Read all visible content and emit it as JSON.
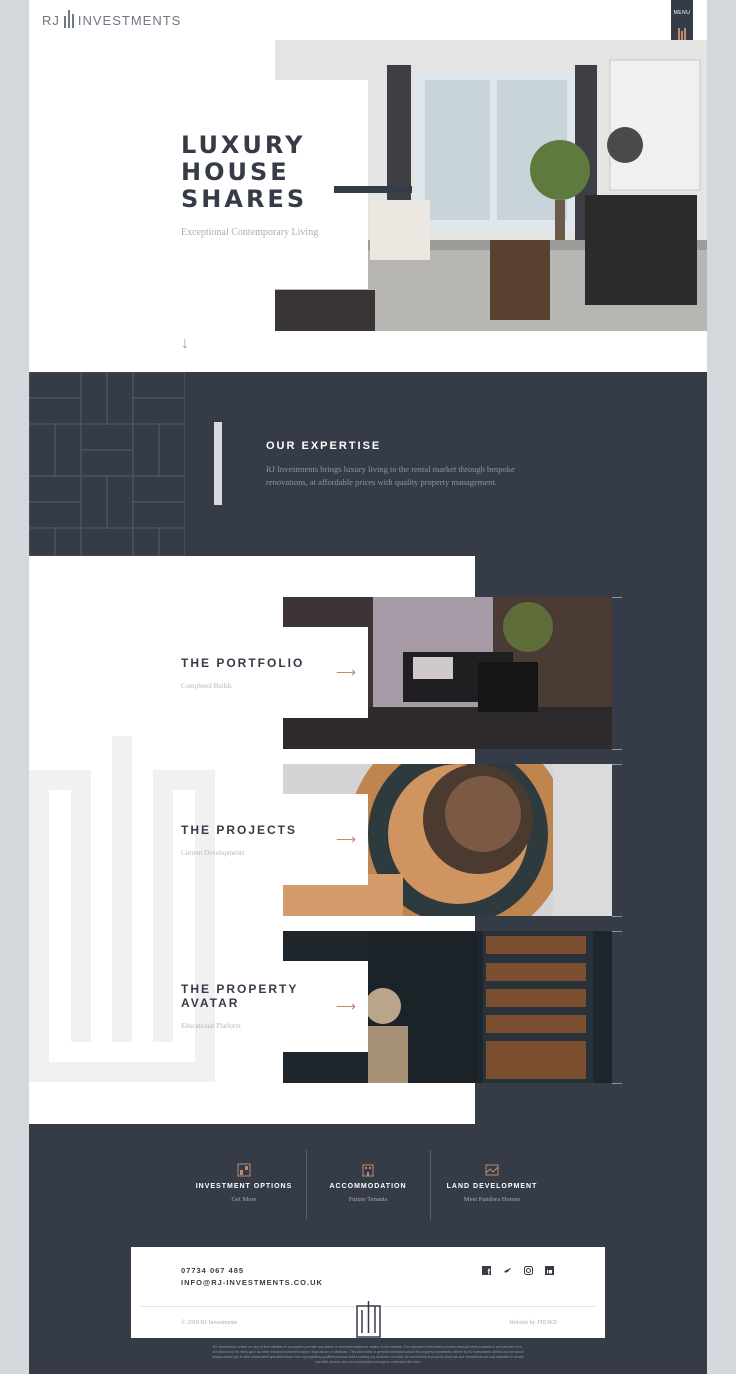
{
  "header": {
    "logo_rj": "RJ",
    "logo_name": "INVESTMENTS",
    "menu_label": "MENU"
  },
  "hero": {
    "title_lines": [
      "LUXURY",
      "HOUSE",
      "SHARES"
    ],
    "subtitle": "Exceptional Contemporary Living",
    "scroll_arrow": "↓"
  },
  "expertise": {
    "title": "OUR EXPERTISE",
    "text": "RJ Investments brings luxury living to the rental market through bespoke renovations, at affordable prices with quality property management."
  },
  "sections": [
    {
      "title": "THE PORTFOLIO",
      "subtitle": "Completed Builds",
      "arrow": "⟶"
    },
    {
      "title": "THE PROJECTS",
      "subtitle": "Current Developments",
      "arrow": "⟶"
    },
    {
      "title": "THE PROPERTY AVATAR",
      "subtitle": "Educational Platform",
      "arrow": "⟶"
    }
  ],
  "features": [
    {
      "title": "INVESTMENT OPTIONS",
      "subtitle": "Get More",
      "icon": "investment-icon"
    },
    {
      "title": "ACCOMMODATION",
      "subtitle": "Future Tenants",
      "icon": "building-icon"
    },
    {
      "title": "LAND DEVELOPMENT",
      "subtitle": "Meet Pandora Homes",
      "icon": "land-icon"
    }
  ],
  "contact": {
    "phone": "07734 067 485",
    "email": "INFO@RJ-INVESTMENTS.CO.UK"
  },
  "social": [
    "facebook-icon",
    "twitter-icon",
    "instagram-icon",
    "linkedin-icon"
  ],
  "footer": {
    "copyright": "© 2018 RJ Investments",
    "website_by": "Website by FHOKE",
    "legal": "RJ Investments Limited nor any of their affiliates or companies provides any advice or recommendations in relation to this website. The investment information provided throughout this website is not intended to be, and should not be relied upon as either financial investment advice, legal advice or otherwise. This information is general information about the property investments offered by RJ Investments Limited and we would always advise you to take independent specialist advice from appropriately qualified persons before making any decisions to invest. All investments in property carry risk and investments are only available to certain specified persons who are sophisticated enough to understand the risks."
  },
  "colors": {
    "navy": "#363c47",
    "accent": "#c08a6f",
    "muted": "#a9adb3"
  }
}
